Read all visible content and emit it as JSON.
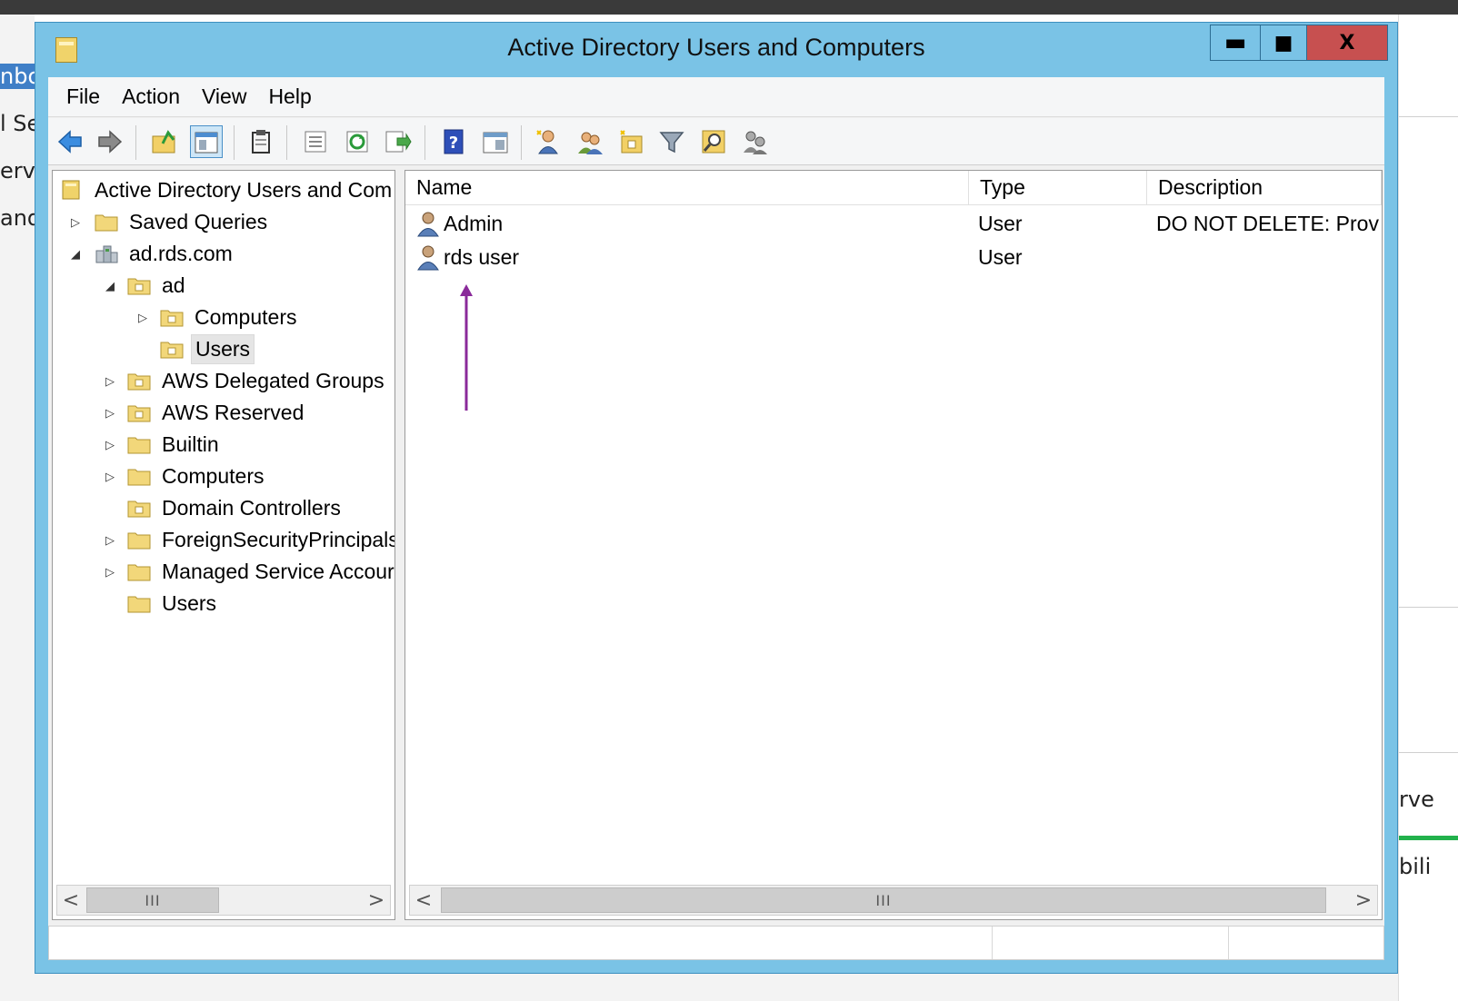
{
  "background": {
    "left_fragments": [
      "nbo",
      "l Se",
      "erv",
      "and"
    ],
    "right_fragments": [
      "rve",
      "bili"
    ]
  },
  "window": {
    "title": "Active Directory Users and Computers",
    "minimize_label": "▬",
    "maximize_label": "■",
    "close_label": "X"
  },
  "menu": {
    "items": [
      "File",
      "Action",
      "View",
      "Help"
    ]
  },
  "toolbar": {
    "buttons": [
      "back-arrow-icon",
      "forward-arrow-icon",
      "up-folder-icon",
      "show-tree-icon",
      "clipboard-icon",
      "properties-icon",
      "refresh-icon",
      "export-list-icon",
      "help-icon",
      "console-view-icon",
      "new-user-icon",
      "new-group-icon",
      "new-ou-icon",
      "filter-icon",
      "find-icon",
      "delegate-icon"
    ]
  },
  "tree": {
    "root": "Active Directory Users and Com",
    "saved_queries": "Saved Queries",
    "domain": "ad.rds.com",
    "ad": "ad",
    "ad_computers": "Computers",
    "ad_users": "Users",
    "aws_delegated": "AWS Delegated Groups",
    "aws_reserved": "AWS Reserved",
    "builtin": "Builtin",
    "computers": "Computers",
    "domain_controllers": "Domain Controllers",
    "fsp": "ForeignSecurityPrincipals",
    "msa": "Managed Service Accour",
    "users": "Users"
  },
  "list": {
    "columns": [
      "Name",
      "Type",
      "Description"
    ],
    "rows": [
      {
        "name": "Admin",
        "type": "User",
        "description": "DO NOT DELETE:  Provi..."
      },
      {
        "name": "rds user",
        "type": "User",
        "description": ""
      }
    ]
  },
  "scrollbar": {
    "left_label": "<",
    "right_label": ">",
    "thumb_label": "III"
  },
  "colors": {
    "title_bar": "#7ac3e6",
    "close_button": "#c75050",
    "annotation_arrow": "#8a2a9a"
  }
}
